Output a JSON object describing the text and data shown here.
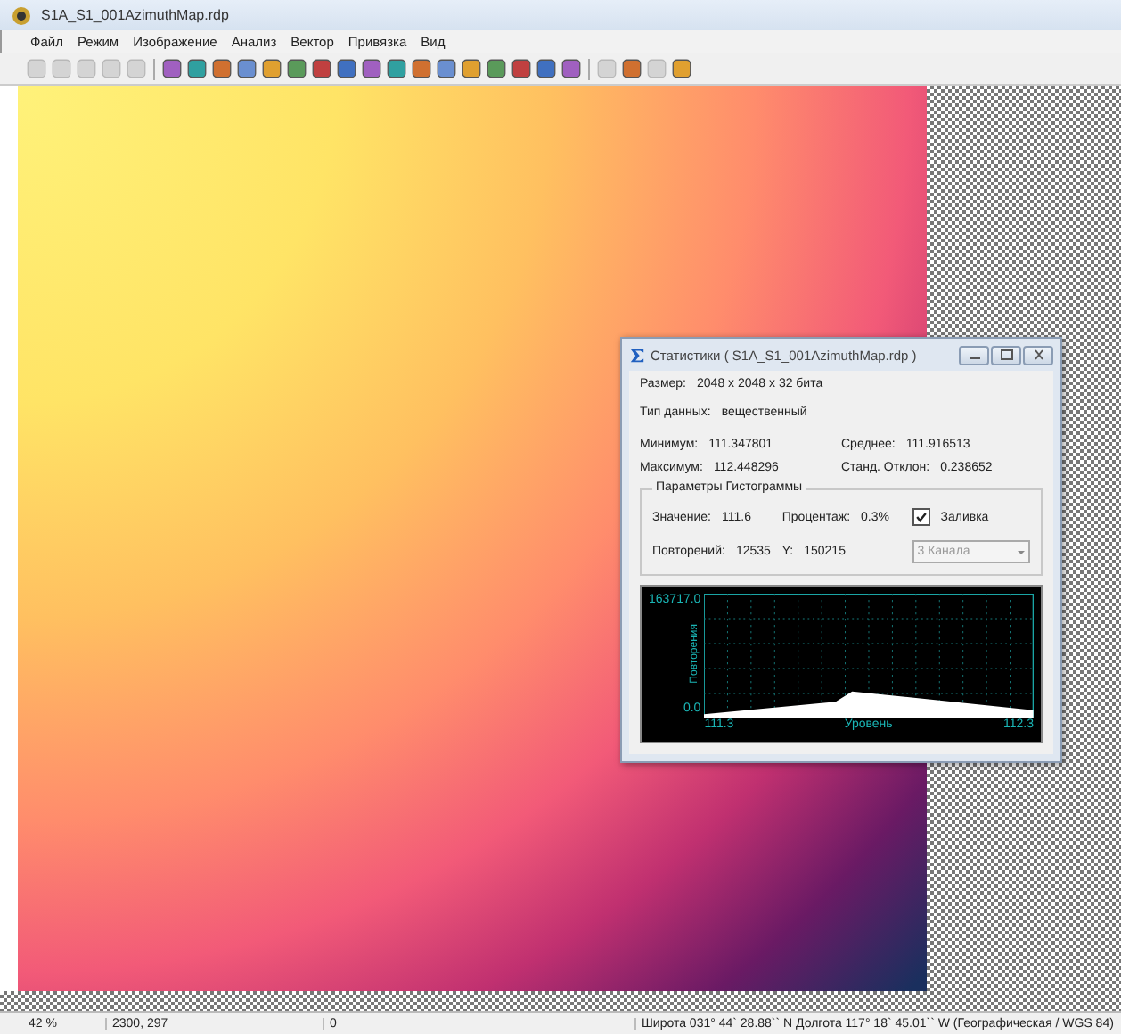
{
  "window": {
    "title": "S1A_S1_001AzimuthMap.rdp"
  },
  "menu": [
    "Файл",
    "Режим",
    "Изображение",
    "Анализ",
    "Вектор",
    "Привязка",
    "Вид"
  ],
  "toolbar": [
    {
      "disabled": true
    },
    {
      "disabled": true
    },
    {
      "disabled": true
    },
    {
      "disabled": true
    },
    {
      "disabled": true
    },
    {
      "disabled": false
    },
    {
      "disabled": false
    },
    {
      "disabled": false
    },
    {
      "disabled": false
    },
    {
      "disabled": false
    },
    {
      "disabled": false
    },
    {
      "disabled": false
    },
    {
      "disabled": false
    },
    {
      "disabled": false
    },
    {
      "disabled": false
    },
    {
      "disabled": false
    },
    {
      "disabled": false
    },
    {
      "disabled": false
    },
    {
      "disabled": false
    },
    {
      "disabled": false
    },
    {
      "disabled": false
    },
    {
      "disabled": false
    },
    {
      "disabled": true
    },
    {
      "disabled": false
    },
    {
      "disabled": true
    },
    {
      "disabled": false
    }
  ],
  "dialog": {
    "title": "Статистики ( S1A_S1_001AzimuthMap.rdp )",
    "size_label": "Размер:",
    "size_value": "2048 x 2048 x 32 бита",
    "type_label": "Тип данных:",
    "type_value": "вещественный",
    "min_label": "Минимум:",
    "min_value": "111.347801",
    "mean_label": "Среднее:",
    "mean_value": "111.916513",
    "max_label": "Максимум:",
    "max_value": "112.448296",
    "std_label": "Станд. Отклон:",
    "std_value": "0.238652",
    "group_title": "Параметры Гистограммы",
    "value_label": "Значение:",
    "value_value": "111.6",
    "percent_label": "Процентаж:",
    "percent_value": "0.3%",
    "fill_label": "Заливка",
    "fill_checked": true,
    "repeats_label": "Повторений:",
    "repeats_value": "12535",
    "y_label": "Y:",
    "y_value": "150215",
    "channel_select": {
      "value": "3 Канала",
      "disabled": true
    },
    "histogram": {
      "y_max": "163717.0",
      "y_min": "0.0",
      "y_title": "Повторения",
      "x_min": "111.3",
      "x_max": "112.3",
      "x_title": "Уровень"
    }
  },
  "status_bar": [
    "42 %",
    "2300, 297",
    "0",
    "Широта 031° 44` 28.88`` N Долгота 117° 18` 45.01`` W (Географическая / WGS 84)"
  ]
}
